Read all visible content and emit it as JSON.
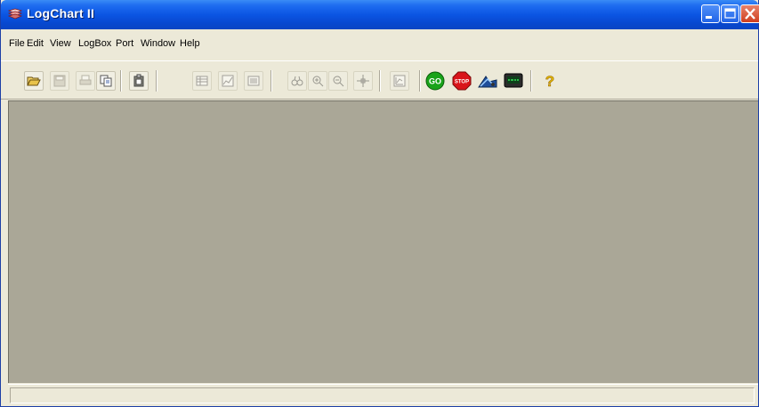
{
  "window": {
    "title": "LogChart II"
  },
  "menu": [
    {
      "label": "File"
    },
    {
      "label": "Edit"
    },
    {
      "label": "View"
    },
    {
      "label": "LogBox"
    },
    {
      "label": "Port"
    },
    {
      "label": "Window"
    },
    {
      "label": "Help"
    }
  ],
  "toolbar": {
    "go_label": "GO",
    "stop_label": "STOP"
  },
  "status": {
    "text": ""
  },
  "colors": {
    "titlebar": "#0b55e3",
    "chrome": "#ece9d8",
    "client": "#aaa797",
    "go": "#1aa31a",
    "stop": "#d9151b"
  }
}
